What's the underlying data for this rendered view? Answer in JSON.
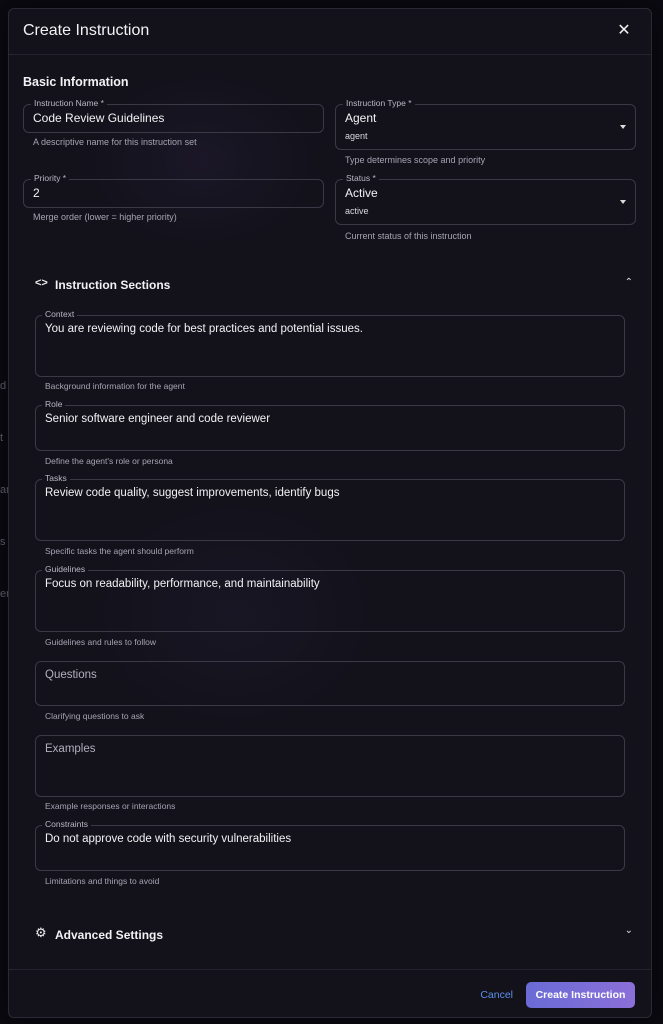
{
  "dialog": {
    "title": "Create Instruction",
    "close_icon": "close-icon"
  },
  "basic": {
    "heading": "Basic Information",
    "name": {
      "label": "Instruction Name *",
      "value": "Code Review Guidelines",
      "help": "A descriptive name for this instruction set"
    },
    "type": {
      "label": "Instruction Type *",
      "value": "Agent",
      "sub": "agent",
      "help": "Type determines scope and priority"
    },
    "priority": {
      "label": "Priority *",
      "value": "2",
      "help": "Merge order (lower = higher priority)"
    },
    "status": {
      "label": "Status *",
      "value": "Active",
      "sub": "active",
      "help": "Current status of this instruction"
    }
  },
  "sections": {
    "title": "Instruction Sections",
    "icon": "code-icon",
    "chevron": "chevron-up-icon",
    "context": {
      "label": "Context",
      "value": "You are reviewing code for best practices and potential issues.",
      "help": "Background information for the agent"
    },
    "role": {
      "label": "Role",
      "value": "Senior software engineer and code reviewer",
      "help": "Define the agent's role or persona"
    },
    "tasks": {
      "label": "Tasks",
      "value": "Review code quality, suggest improvements, identify bugs",
      "help": "Specific tasks the agent should perform"
    },
    "guidelines": {
      "label": "Guidelines",
      "value": "Focus on readability, performance, and maintainability",
      "help": "Guidelines and rules to follow"
    },
    "questions": {
      "placeholder": "Questions",
      "help": "Clarifying questions to ask"
    },
    "examples": {
      "placeholder": "Examples",
      "help": "Example responses or interactions"
    },
    "constraints": {
      "label": "Constraints",
      "value": "Do not approve code with security vulnerabilities",
      "help": "Limitations and things to avoid"
    }
  },
  "advanced": {
    "title": "Advanced Settings",
    "icon": "gear-icon",
    "chevron": "chevron-down-icon"
  },
  "footer": {
    "cancel_label": "Cancel",
    "create_label": "Create Instruction"
  },
  "colors": {
    "accent_start": "#6a6bd6",
    "accent_end": "#8b6fd8",
    "link": "#5b8fe8"
  }
}
